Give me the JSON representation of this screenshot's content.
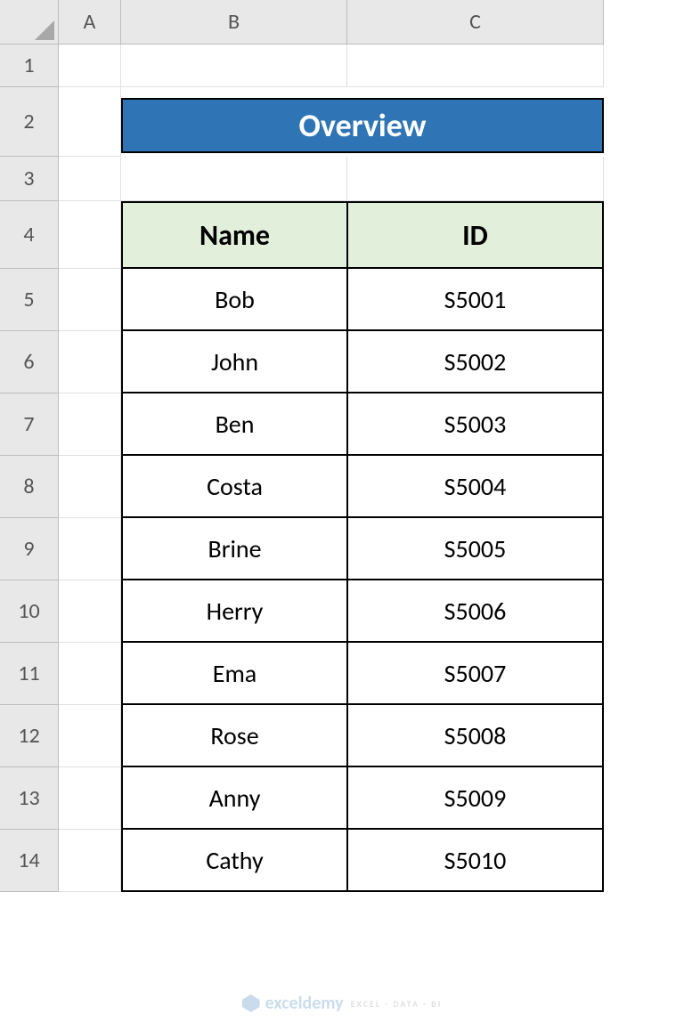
{
  "columns": [
    "A",
    "B",
    "C"
  ],
  "rows": [
    "1",
    "2",
    "3",
    "4",
    "5",
    "6",
    "7",
    "8",
    "9",
    "10",
    "11",
    "12",
    "13",
    "14"
  ],
  "title": "Overview",
  "table": {
    "headers": {
      "name": "Name",
      "id": "ID"
    },
    "data": [
      {
        "name": "Bob",
        "id": "S5001"
      },
      {
        "name": "John",
        "id": "S5002"
      },
      {
        "name": "Ben",
        "id": "S5003"
      },
      {
        "name": "Costa",
        "id": "S5004"
      },
      {
        "name": "Brine",
        "id": "S5005"
      },
      {
        "name": "Herry",
        "id": "S5006"
      },
      {
        "name": "Ema",
        "id": "S5007"
      },
      {
        "name": "Rose",
        "id": "S5008"
      },
      {
        "name": "Anny",
        "id": "S5009"
      },
      {
        "name": "Cathy",
        "id": "S5010"
      }
    ]
  },
  "watermark": {
    "brand": "exceldemy",
    "tagline": "EXCEL · DATA · BI"
  }
}
